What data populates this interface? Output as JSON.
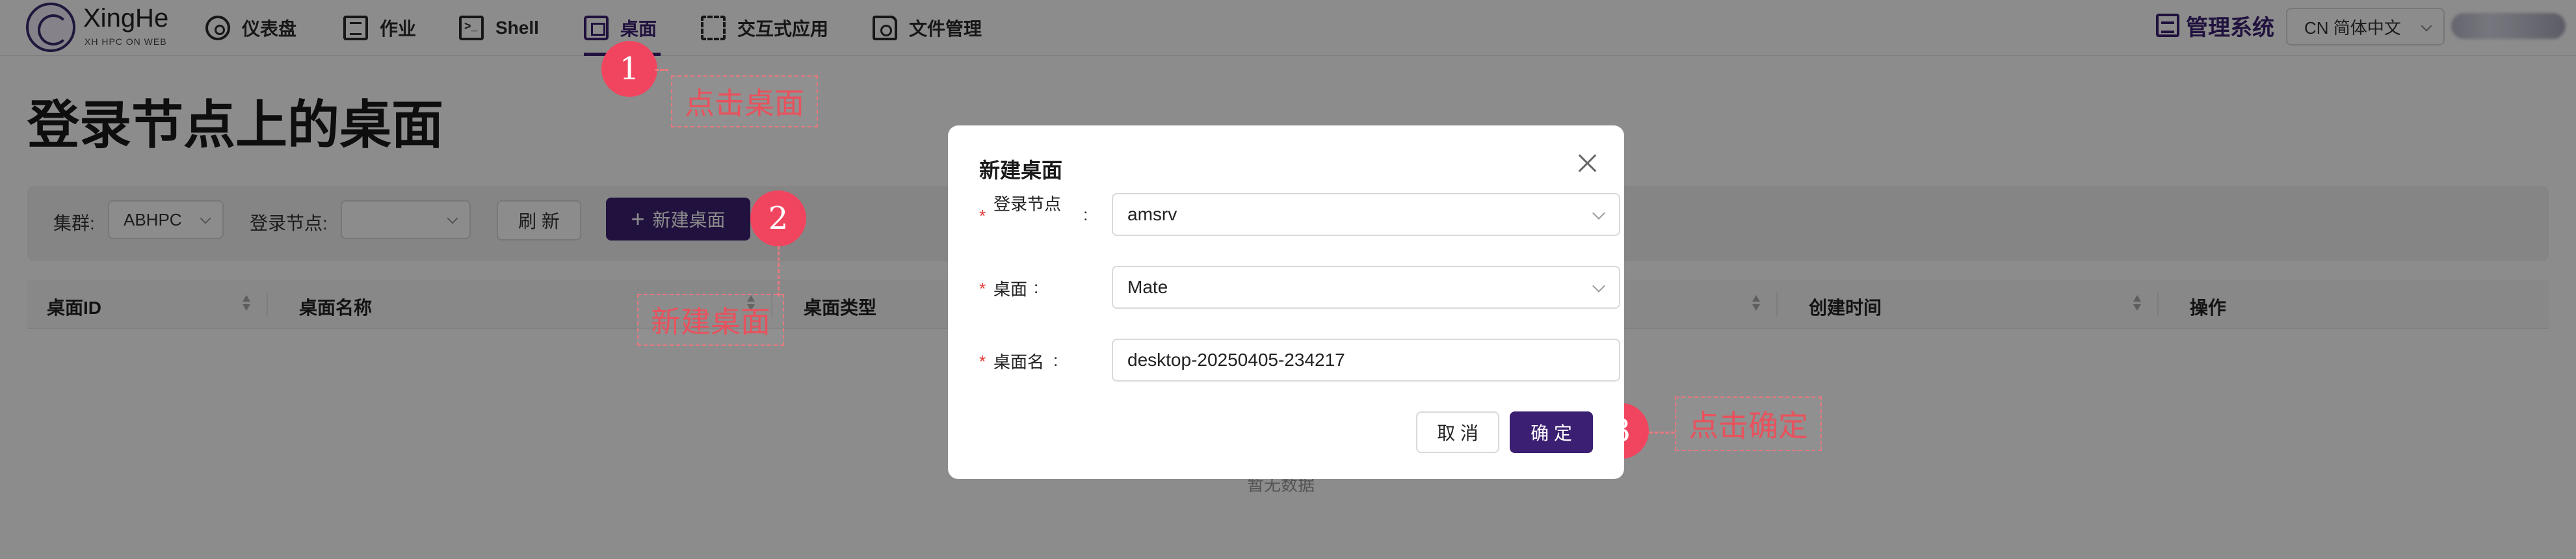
{
  "header": {
    "logo_title": "XingHe",
    "logo_sub": "XH HPC ON WEB",
    "nav": [
      {
        "label": "仪表盘",
        "icon": "dashboard-icon"
      },
      {
        "label": "作业",
        "icon": "job-list-icon"
      },
      {
        "label": "Shell",
        "icon": "terminal-icon"
      },
      {
        "label": "桌面",
        "icon": "desktop-icon",
        "active": true
      },
      {
        "label": "交互式应用",
        "icon": "interactive-app-icon"
      },
      {
        "label": "文件管理",
        "icon": "file-manager-icon"
      }
    ],
    "admin_label": "管理系统",
    "language": "CN 简体中文"
  },
  "page": {
    "title": "登录节点上的桌面",
    "filter": {
      "cluster_label": "集群:",
      "cluster_value": "ABHPC",
      "node_label": "登录节点:",
      "node_value": "",
      "refresh_label": "刷 新",
      "new_label": "新建桌面"
    },
    "table": {
      "columns": [
        "桌面ID",
        "桌面名称",
        "桌面类型",
        "创建时间",
        "操作"
      ],
      "empty_text": "暂无数据"
    }
  },
  "modal": {
    "title": "新建桌面",
    "fields": [
      {
        "label": "登录节点",
        "value": "amsrv",
        "type": "select"
      },
      {
        "label": "桌面",
        "value": "Mate",
        "type": "select"
      },
      {
        "label": "桌面名",
        "value": "desktop-20250405-234217",
        "type": "input"
      }
    ],
    "cancel_label": "取 消",
    "ok_label": "确 定"
  },
  "annotations": [
    {
      "step": "1",
      "text": "点击桌面"
    },
    {
      "step": "2",
      "text": "新建桌面"
    },
    {
      "step": "3",
      "text": "点击确定"
    }
  ],
  "colors": {
    "brand": "#3b1f72",
    "annotation": "#f1455f",
    "required": "#e53935"
  }
}
